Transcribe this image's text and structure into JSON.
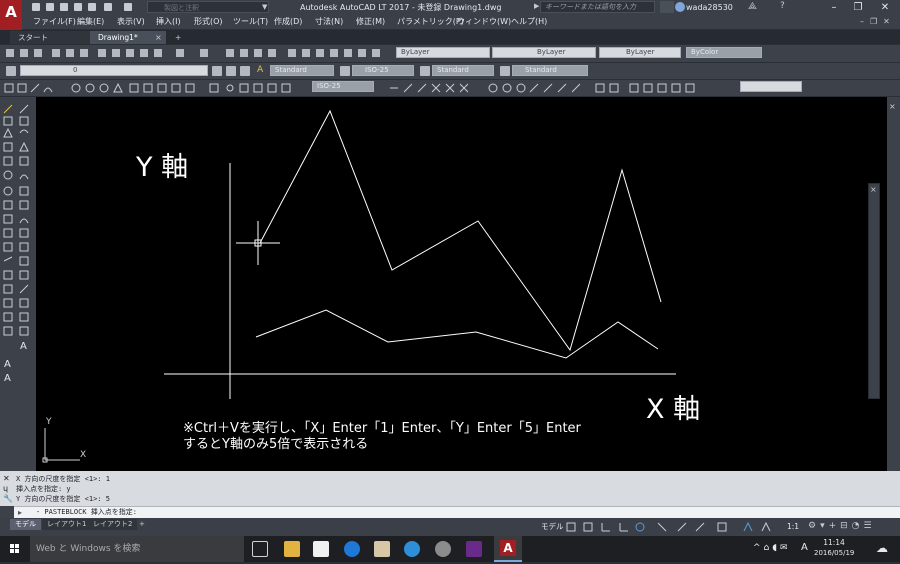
{
  "titlebar": {
    "app_letter": "A",
    "app_badge": "LT",
    "workspace": "製図と注釈",
    "title": "Autodesk AutoCAD LT 2017 - 未登録    Drawing1.dwg",
    "search_placeholder": "キーワードまたは語句を入力",
    "user": "wada28530"
  },
  "menu": [
    "ファイル(F)",
    "編集(E)",
    "表示(V)",
    "挿入(I)",
    "形式(O)",
    "ツール(T)",
    "作成(D)",
    "寸法(N)",
    "修正(M)",
    "パラメトリック(P)",
    "ウィンドウ(W)",
    "ヘルプ(H)"
  ],
  "tabs": [
    {
      "label": "スタート",
      "active": false
    },
    {
      "label": "Drawing1*",
      "active": true
    },
    {
      "label": "+",
      "active": false
    }
  ],
  "properties": {
    "color": "ByLayer",
    "linetype": "ByLayer",
    "lineweight": "ByLayer",
    "plotstyle": "ByColor"
  },
  "styles": {
    "layer": "0",
    "text_style": "Standard",
    "dim_style": "ISO-25",
    "table_style": "Standard",
    "mleader_style": "Standard",
    "dim_style_2": "ISO-25"
  },
  "canvas": {
    "y_axis_label": "Y 軸",
    "x_axis_label": "X 軸",
    "instruction_line1": "※Ctrl＋Vを実行し、「X」Enter「1」Enter、「Y」Enter「5」Enter",
    "instruction_line2": "するとY軸のみ5倍で表示される",
    "ucs_y": "Y",
    "ucs_x": "X"
  },
  "command_history": [
    "X 方向の尺度を指定 <1>: 1",
    "挿入点を指定: y",
    "Y 方向の尺度を指定 <1>: 5"
  ],
  "command_prompt": "- PASTEBLOCK 挿入点を指定:",
  "layout_tabs": [
    {
      "label": "モデル",
      "active": true
    },
    {
      "label": "レイアウト1",
      "active": false
    },
    {
      "label": "レイアウト2",
      "active": false
    },
    {
      "label": "+",
      "active": false
    }
  ],
  "status": {
    "model_label": "モデル",
    "scale": "1:1"
  },
  "taskbar": {
    "search_placeholder": "Web と Windows を検索",
    "ime": "A",
    "time": "11:14",
    "date": "2016/05/19"
  },
  "colors": {
    "app_red": "#a11e22",
    "canvas_bg": "#000000",
    "ui_dark": "#3c414a"
  }
}
